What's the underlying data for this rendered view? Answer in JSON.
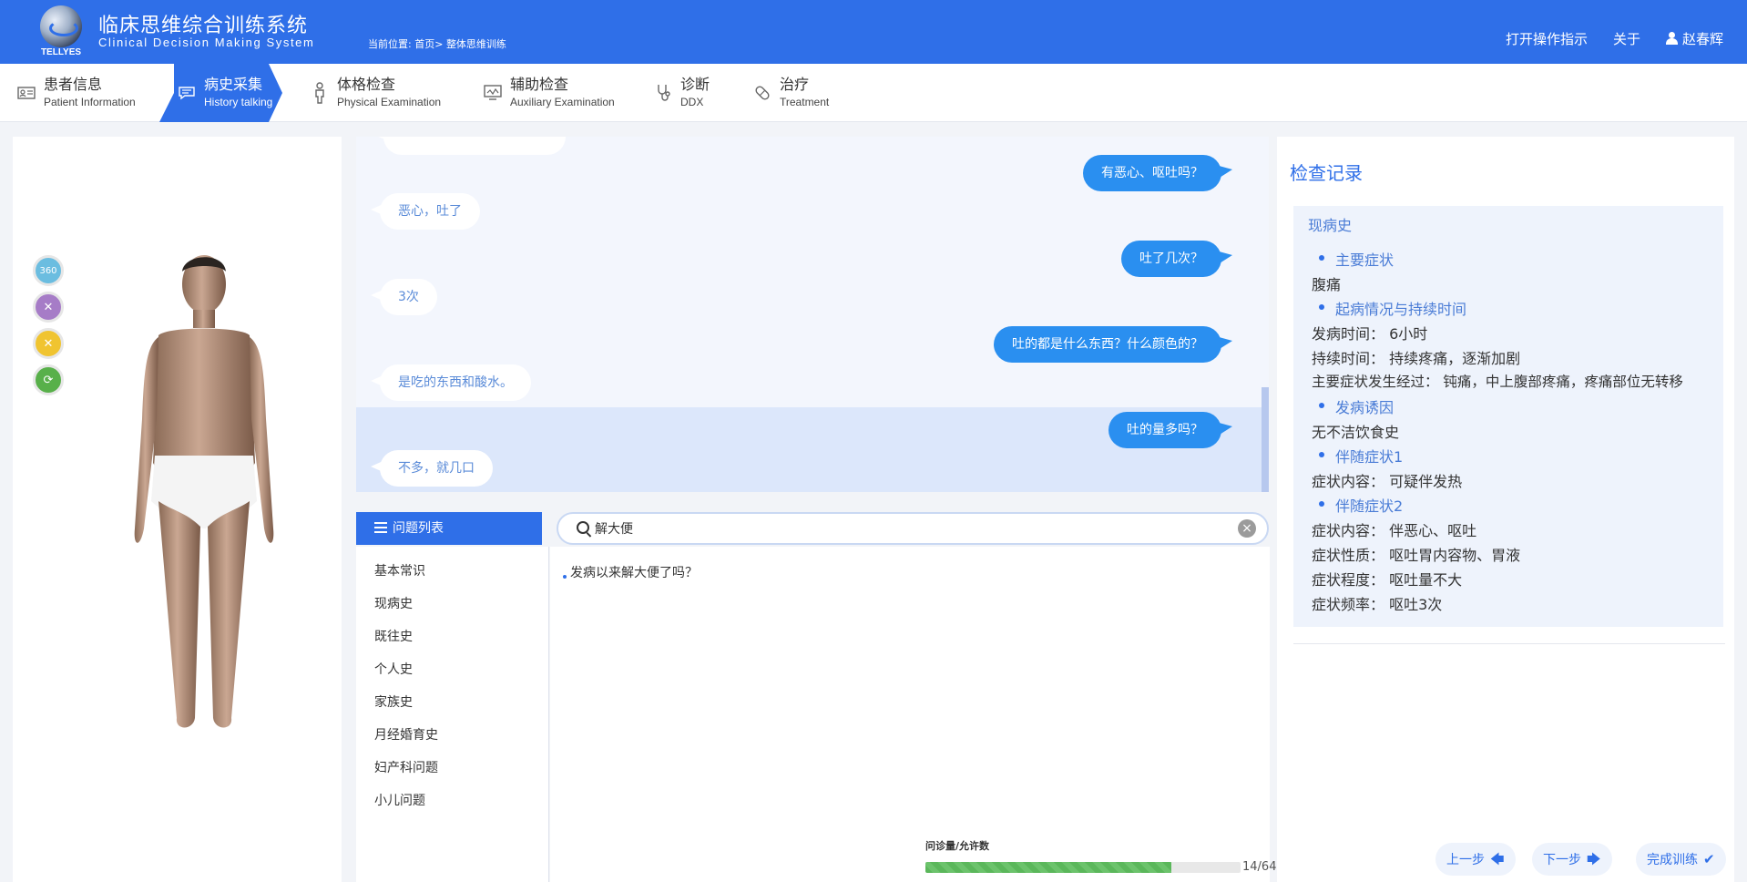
{
  "header": {
    "brand": "TELLYES",
    "title": "临床思维综合训练系统",
    "subtitle": "Clinical Decision Making System",
    "breadcrumb_prefix": "当前位置:",
    "breadcrumb_home": "首页>",
    "breadcrumb_current": "整体思维训练",
    "guide_link": "打开操作指示",
    "about_link": "关于",
    "user_name": "赵春辉"
  },
  "steps": [
    {
      "cn": "患者信息",
      "en": "Patient Information",
      "icon": "id-card-icon"
    },
    {
      "cn": "病史采集",
      "en": "History talking",
      "icon": "chat-icon",
      "active": true
    },
    {
      "cn": "体格检查",
      "en": "Physical Examination",
      "icon": "person-icon"
    },
    {
      "cn": "辅助检查",
      "en": "Auxiliary Examination",
      "icon": "monitor-icon"
    },
    {
      "cn": "诊断",
      "en": "DDX",
      "icon": "stethoscope-icon"
    },
    {
      "cn": "治疗",
      "en": "Treatment",
      "icon": "pill-icon"
    }
  ],
  "tools": [
    {
      "name": "rotate-360-icon",
      "label": "360",
      "color": "#6bbde0"
    },
    {
      "name": "shrink-icon",
      "label": "✕",
      "color": "#a67cc7"
    },
    {
      "name": "expand-icon",
      "label": "✕",
      "color": "#f0c430"
    },
    {
      "name": "reset-icon",
      "label": "⟳",
      "color": "#58b04a"
    }
  ],
  "chat": [
    {
      "role": "q",
      "text": "有恶心、呕吐吗？"
    },
    {
      "role": "a",
      "text": "恶心，吐了"
    },
    {
      "role": "q",
      "text": "吐了几次？"
    },
    {
      "role": "a",
      "text": "3次"
    },
    {
      "role": "q",
      "text": "吐的都是什么东西？什么颜色的？"
    },
    {
      "role": "a",
      "text": "是吃的东西和酸水。"
    },
    {
      "role": "q",
      "text": "吐的量多吗？"
    },
    {
      "role": "a",
      "text": "不多，就几口"
    }
  ],
  "question_list": {
    "header": "问题列表",
    "categories": [
      "基本常识",
      "现病史",
      "既往史",
      "个人史",
      "家族史",
      "月经婚育史",
      "妇产科问题",
      "小儿问题"
    ]
  },
  "search": {
    "value": "解大便",
    "results": [
      "发病以来解大便了吗？"
    ]
  },
  "progress": {
    "label": "问诊量/允许数",
    "current": 14,
    "max": 64,
    "display": "14/64"
  },
  "record": {
    "title": "检查记录",
    "section": "现病史",
    "items": [
      {
        "type": "sec",
        "text": "主要症状"
      },
      {
        "type": "v",
        "text": "腹痛"
      },
      {
        "type": "sec",
        "text": "起病情况与持续时间"
      },
      {
        "type": "v",
        "text": "发病时间： 6小时"
      },
      {
        "type": "v",
        "text": "持续时间： 持续疼痛，逐渐加剧"
      },
      {
        "type": "v",
        "text": "主要症状发生经过： 钝痛，中上腹部疼痛，疼痛部位无转移"
      },
      {
        "type": "sec",
        "text": "发病诱因"
      },
      {
        "type": "v",
        "text": "无不洁饮食史"
      },
      {
        "type": "sec",
        "text": "伴随症状1"
      },
      {
        "type": "v",
        "text": "症状内容： 可疑伴发热"
      },
      {
        "type": "sec",
        "text": "伴随症状2"
      },
      {
        "type": "v",
        "text": "症状内容： 伴恶心、呕吐"
      },
      {
        "type": "v",
        "text": "症状性质： 呕吐胃内容物、胃液"
      },
      {
        "type": "v",
        "text": "症状程度： 呕吐量不大"
      },
      {
        "type": "v",
        "text": "症状频率： 呕吐3次"
      }
    ]
  },
  "buttons": {
    "prev": "上一步",
    "next": "下一步",
    "finish": "完成训练"
  }
}
